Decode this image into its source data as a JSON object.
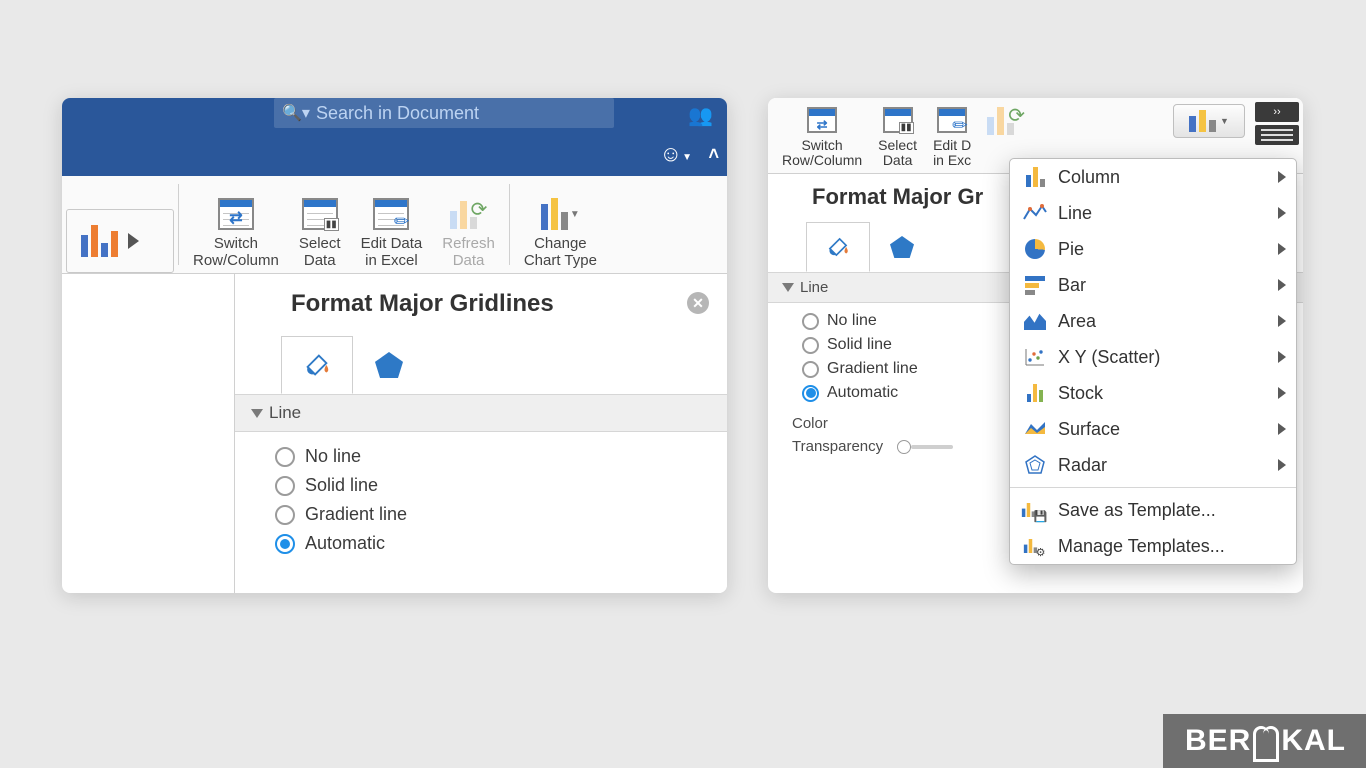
{
  "watermark": "BER KAL",
  "left": {
    "search_placeholder": "Search in Document",
    "toolbar": {
      "switch": "Switch\nRow/Column",
      "select": "Select\nData",
      "edit": "Edit Data\nin Excel",
      "refresh": "Refresh\nData",
      "change": "Change\nChart Type"
    },
    "pane": {
      "title": "Format Major Gridlines",
      "section": "Line",
      "options": [
        "No line",
        "Solid line",
        "Gradient line",
        "Automatic"
      ],
      "selected": "Automatic"
    }
  },
  "right": {
    "toolbar": {
      "switch": "Switch\nRow/Column",
      "select": "Select\nData",
      "edit": "Edit D\nin Exc"
    },
    "pane": {
      "title": "Format Major Gr",
      "section": "Line",
      "options": [
        "No line",
        "Solid line",
        "Gradient line",
        "Automatic"
      ],
      "selected": "Automatic",
      "color_label": "Color",
      "transparency_label": "Transparency"
    },
    "dropdown": {
      "types": [
        "Column",
        "Line",
        "Pie",
        "Bar",
        "Area",
        "X Y (Scatter)",
        "Stock",
        "Surface",
        "Radar"
      ],
      "save": "Save as Template...",
      "manage": "Manage Templates..."
    }
  }
}
